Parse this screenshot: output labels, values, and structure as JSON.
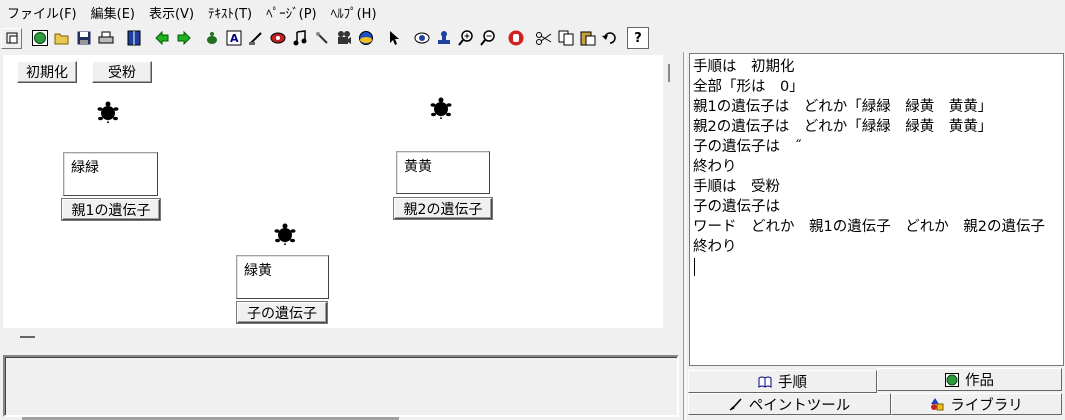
{
  "menu": [
    "ファイル(F)",
    "編集(E)",
    "表示(V)",
    "ﾃｷｽﾄ(T)",
    "ﾍﾟｰｼﾞ(P)",
    "ﾍﾙﾌﾟ(H)"
  ],
  "toolbar": {
    "icons": [
      "window-icon",
      "globe-icon",
      "open-folder-icon",
      "save-disk-icon",
      "print-icon",
      "book-icon",
      "arrow-left-icon",
      "arrow-right-icon",
      "turtle-add-icon",
      "text-box-icon",
      "brush-icon",
      "eye-record-icon",
      "music-note-icon",
      "pen-icon",
      "movie-camera-icon",
      "globe-network-icon",
      "pointer-icon",
      "eye-icon",
      "stamp-icon",
      "zoom-in-icon",
      "zoom-out-icon",
      "stop-hand-icon",
      "cut-icon",
      "copy-icon",
      "paste-icon",
      "undo-icon",
      "help-icon"
    ],
    "help_label": "?"
  },
  "canvas": {
    "buttons": {
      "init": "初期化",
      "pollinate": "受粉"
    },
    "variables": [
      {
        "value": "緑緑",
        "label": "親1の遺伝子"
      },
      {
        "value": "黄黄",
        "label": "親2の遺伝子"
      },
      {
        "value": "緑黄",
        "label": "子の遺伝子"
      }
    ]
  },
  "editor": {
    "lines": [
      "手順は　初期化",
      "全部「形は　0」",
      "親1の遺伝子は　どれか「緑緑　緑黄　黄黄」",
      "親2の遺伝子は　どれか「緑緑　緑黄　黄黄」",
      "子の遺伝子は　˝",
      "終わり",
      "手順は　受粉",
      "子の遺伝子は",
      "ワード　どれか　親1の遺伝子　どれか　親2の遺伝子",
      "終わり"
    ]
  },
  "tabs": {
    "procedure": "手順",
    "work": "作品",
    "paint": "ペイントツール",
    "library": "ライブラリ"
  },
  "colors": {
    "accent": "#0000a0",
    "background": "#f0f0f0"
  }
}
